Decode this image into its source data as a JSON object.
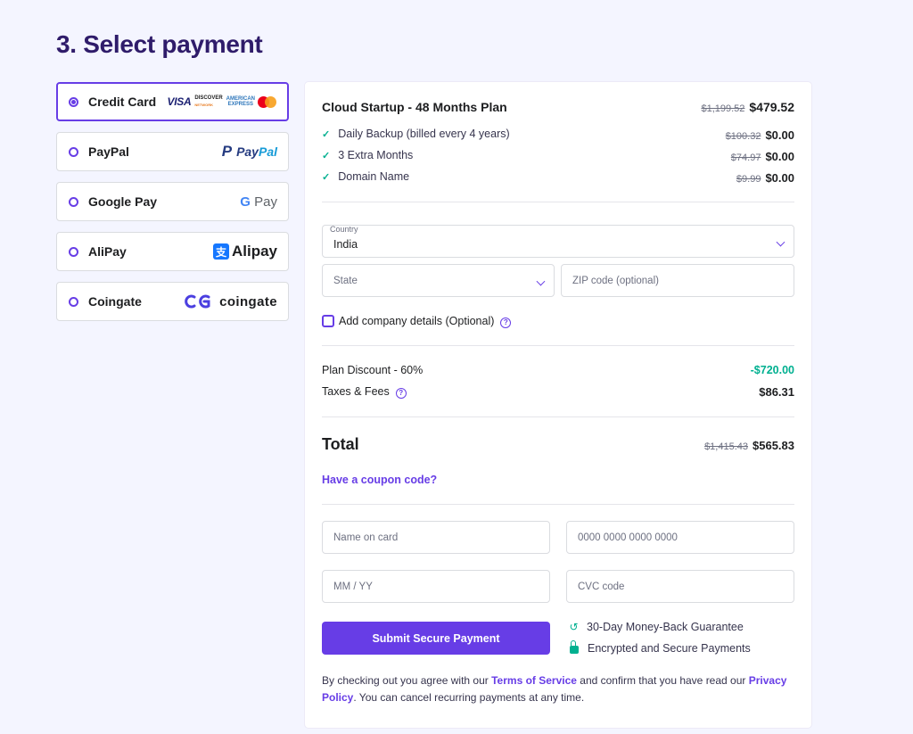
{
  "page_title": "3. Select payment",
  "payment_methods": [
    {
      "label": "Credit Card",
      "selected": true,
      "logos": {
        "visa": "VISA",
        "discover": "DISCOVER",
        "discover_sub": "NETWORK",
        "amex_line1": "AMERICAN",
        "amex_line2": "EXPRESS"
      }
    },
    {
      "label": "PayPal",
      "selected": false,
      "logo_p": "P",
      "logo_pay": "Pay",
      "logo_pal": "Pal"
    },
    {
      "label": "Google Pay",
      "selected": false,
      "logo_g": "G",
      "logo_text": "Pay"
    },
    {
      "label": "AliPay",
      "selected": false,
      "logo_mark": "支",
      "logo_text": "Alipay"
    },
    {
      "label": "Coingate",
      "selected": false,
      "logo_text": "coingate"
    }
  ],
  "order": {
    "plan_name": "Cloud Startup - 48 Months Plan",
    "plan_old_price": "$1,199.52",
    "plan_price": "$479.52",
    "features": [
      {
        "label": "Daily Backup (billed every 4 years)",
        "old": "$100.32",
        "price": "$0.00"
      },
      {
        "label": "3 Extra Months",
        "old": "$74.97",
        "price": "$0.00"
      },
      {
        "label": "Domain Name",
        "old": "$9.99",
        "price": "$0.00"
      }
    ]
  },
  "form": {
    "country_label": "Country",
    "country_value": "India",
    "state_placeholder": "State",
    "zip_placeholder": "ZIP code (optional)",
    "company_checkbox": "Add company details (Optional)",
    "help_glyph": "?"
  },
  "summary": {
    "discount_label": "Plan Discount - 60%",
    "discount_value": "-$720.00",
    "taxes_label": "Taxes & Fees",
    "taxes_value": "$86.31",
    "total_label": "Total",
    "total_old": "$1,415.43",
    "total_value": "$565.83",
    "coupon_link": "Have a coupon code?"
  },
  "card_form": {
    "name_placeholder": "Name on card",
    "number_placeholder": "0000 0000 0000 0000",
    "expiry_placeholder": "MM / YY",
    "cvc_placeholder": "CVC code",
    "submit_label": "Submit Secure Payment"
  },
  "guarantees": {
    "money_back": "30-Day Money-Back Guarantee",
    "secure": "Encrypted and Secure Payments"
  },
  "legal": {
    "part1": "By checking out you agree with our ",
    "tos_link": "Terms of Service",
    "part2": " and confirm that you have read our ",
    "privacy_link": "Privacy Policy",
    "part3": ". You can cancel recurring payments at any time."
  },
  "colors": {
    "accent": "#673de6",
    "heading": "#2f1c6a",
    "success": "#00b090",
    "background": "#f4f5ff"
  }
}
